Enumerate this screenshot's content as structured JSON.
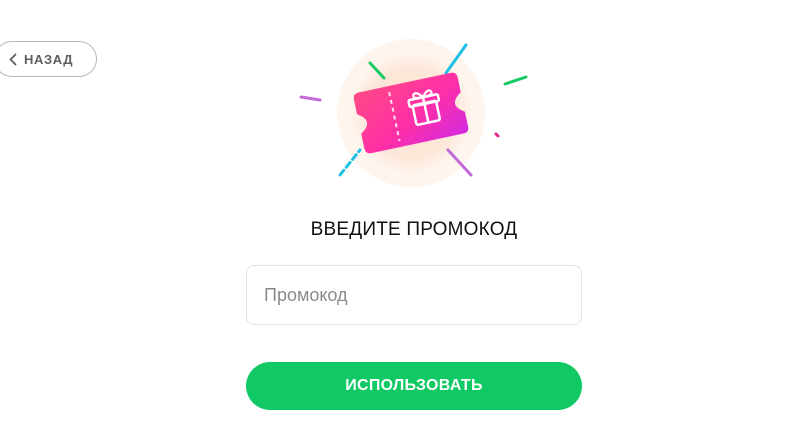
{
  "back_button": {
    "label": "НАЗАД",
    "icon": "chevron-left-icon"
  },
  "illustration": {
    "icon": "gift-ticket-icon"
  },
  "promo": {
    "title": "ВВЕДИТЕ ПРОМОКОД",
    "input_placeholder": "Промокод",
    "input_value": "",
    "submit_label": "ИСПОЛЬЗОВАТЬ"
  },
  "colors": {
    "accent_green": "#10c964",
    "ticket_pink": "#ff2f9a",
    "ticket_magenta": "#e02ad8",
    "halo_peach": "#fde9db",
    "confetti_blue": "#1ec0e6",
    "confetti_green": "#15c964",
    "confetti_purple": "#c06ad8"
  }
}
